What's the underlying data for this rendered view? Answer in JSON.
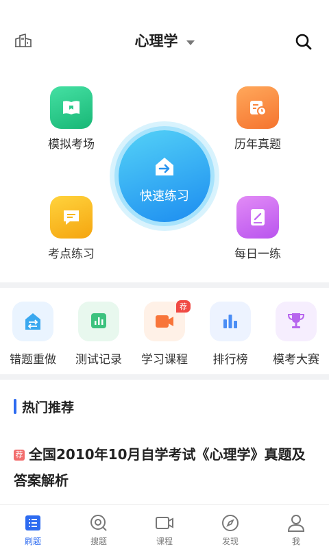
{
  "header": {
    "title": "心理学"
  },
  "quick": {
    "mock": "模拟考场",
    "past": "历年真题",
    "fast": "快速练习",
    "points": "考点练习",
    "daily": "每日一练"
  },
  "shortcuts": [
    {
      "label": "错题重做",
      "icon": "redo-icon"
    },
    {
      "label": "测试记录",
      "icon": "chart-icon"
    },
    {
      "label": "学习课程",
      "icon": "video-icon",
      "badge": "荐"
    },
    {
      "label": "排行榜",
      "icon": "ranking-icon"
    },
    {
      "label": "模考大赛",
      "icon": "trophy-icon"
    }
  ],
  "section": {
    "title": "热门推荐"
  },
  "recommend": {
    "tag": "荐",
    "text": "全国2010年10月自学考试《心理学》真题及答案解析"
  },
  "nav": [
    {
      "label": "刷题",
      "active": true
    },
    {
      "label": "搜题"
    },
    {
      "label": "课程"
    },
    {
      "label": "发现"
    },
    {
      "label": "我"
    }
  ],
  "colors": {
    "accent": "#2d6bf0",
    "green": "#2fc98c",
    "orange": "#f8843c",
    "yellow": "#f7b71c",
    "purple": "#c46ef2"
  }
}
